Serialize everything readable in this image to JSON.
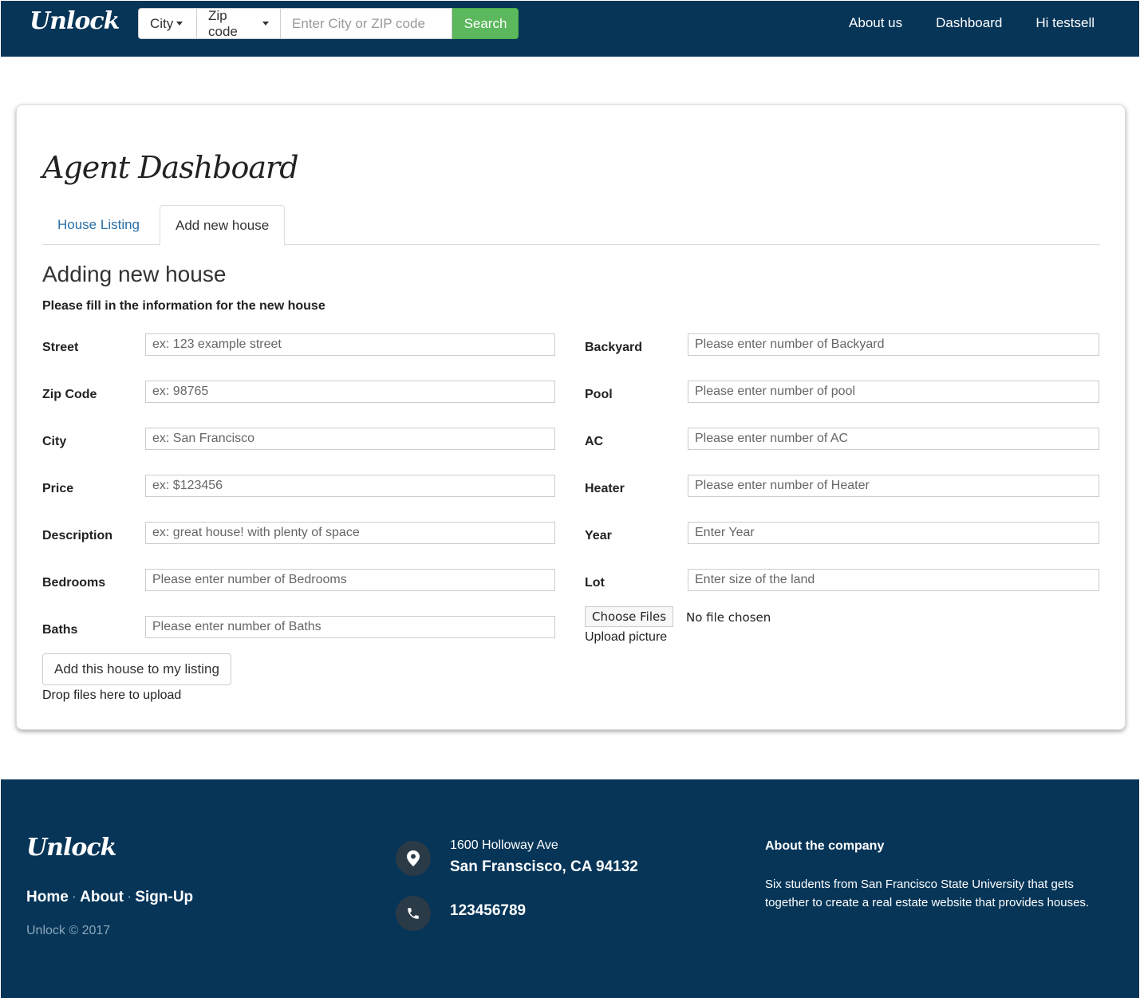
{
  "navbar": {
    "brand": "Unlock",
    "search": {
      "city_dropdown": "City",
      "zip_dropdown": "Zip code",
      "input_placeholder": "Enter City or ZIP code",
      "button": "Search"
    },
    "links": [
      "About us",
      "Dashboard",
      "Hi testsell"
    ]
  },
  "page": {
    "title": "Agent Dashboard",
    "tabs": [
      "House Listing",
      "Add new house"
    ],
    "active_tab": "Add new house",
    "form_heading": "Adding new house",
    "form_subheading": "Please fill in the information for the new house"
  },
  "form": {
    "left": [
      {
        "label": "Street",
        "placeholder": "ex: 123 example street"
      },
      {
        "label": "Zip Code",
        "placeholder": "ex: 98765"
      },
      {
        "label": "City",
        "placeholder": "ex: San Francisco"
      },
      {
        "label": "Price",
        "placeholder": "ex: $123456"
      },
      {
        "label": "Description",
        "placeholder": "ex: great house! with plenty of space"
      },
      {
        "label": "Bedrooms",
        "placeholder": "Please enter number of Bedrooms"
      },
      {
        "label": "Baths",
        "placeholder": "Please enter number of Baths"
      }
    ],
    "right": [
      {
        "label": "Backyard",
        "placeholder": "Please enter number of Backyard"
      },
      {
        "label": "Pool",
        "placeholder": "Please enter number of pool"
      },
      {
        "label": "AC",
        "placeholder": "Please enter number of AC"
      },
      {
        "label": "Heater",
        "placeholder": "Please enter number of Heater"
      },
      {
        "label": "Year",
        "placeholder": "Enter Year"
      },
      {
        "label": "Lot",
        "placeholder": "Enter size of the land"
      }
    ],
    "file_button": "Choose Files",
    "file_status": "No file chosen",
    "upload_label": "Upload picture",
    "submit": "Add this house to my listing",
    "drop_text": "Drop files here to upload"
  },
  "footer": {
    "brand": "Unlock",
    "links": [
      "Home",
      "About",
      "Sign-Up"
    ],
    "link_separator": "·",
    "copyright": "Unlock © 2017",
    "address_line1": "1600 Holloway Ave",
    "address_line2": "San Franscisco, CA 94132",
    "phone": "123456789",
    "about_heading": "About the company",
    "about_text": "Six students from San Francisco State University that gets together to create a real estate website that provides houses."
  },
  "colors": {
    "navbar_bg": "#063558",
    "search_button": "#5cb85c",
    "tab_link": "#2a6fa8",
    "footer_bg": "#063558"
  },
  "icons": [
    "map-marker-icon",
    "phone-icon",
    "caret-down-icon"
  ]
}
